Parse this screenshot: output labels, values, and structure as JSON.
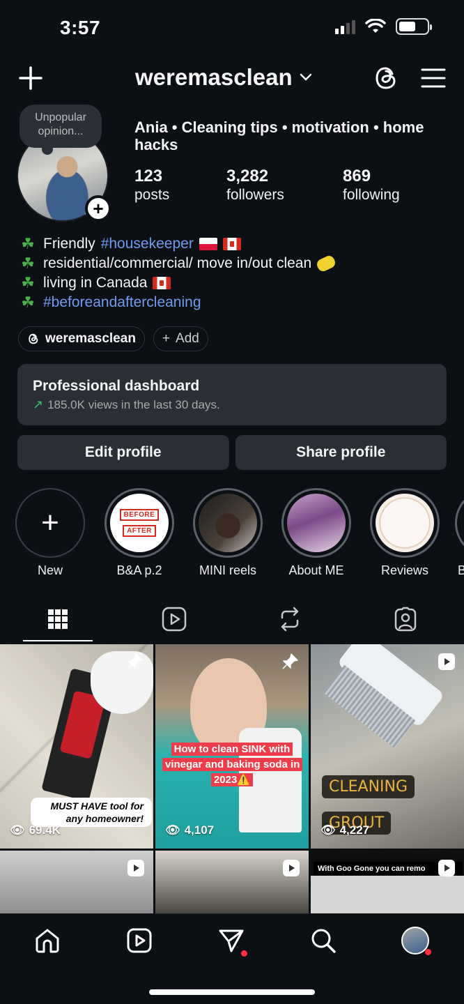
{
  "status_bar": {
    "time": "3:57"
  },
  "header": {
    "username": "weremasclean"
  },
  "profile": {
    "note": "Unpopular opinion...",
    "display_name": "Ania • Cleaning tips • motivation • home hacks",
    "stats": [
      {
        "value": "123",
        "label": "posts"
      },
      {
        "value": "3,282",
        "label": "followers"
      },
      {
        "value": "869",
        "label": "following"
      }
    ],
    "bio": {
      "line1_text": "Friendly",
      "line1_tag": "#housekeeper",
      "line2_text": "residential/commercial/ move in/out clean",
      "line3_text": "living in Canada",
      "line4_tag": "#beforeandaftercleaning"
    },
    "chips": {
      "threads_label": "weremasclean",
      "add_label": "Add"
    }
  },
  "dashboard": {
    "title": "Professional dashboard",
    "subtitle": "185.0K views in the last 30 days."
  },
  "actions": {
    "edit_label": "Edit profile",
    "share_label": "Share profile"
  },
  "highlights": [
    {
      "label": "New"
    },
    {
      "label": "B&A p.2",
      "badge_top": "BEFORE",
      "badge_bottom": "AFTER"
    },
    {
      "label": "MINI reels"
    },
    {
      "label": "About ME"
    },
    {
      "label": "Reviews"
    },
    {
      "label": "B"
    }
  ],
  "posts": [
    {
      "caption": "MUST HAVE tool for any homeowner!",
      "views": "69.4K",
      "pinned": true
    },
    {
      "caption": "How to clean SINK with vinegar and baking soda in 2023⚠️",
      "views": "4,107",
      "pinned": true
    },
    {
      "caption_line1": "CLEANING",
      "caption_line2": "GROUT",
      "views": "4,227",
      "reel": true
    },
    {
      "reel": true
    },
    {
      "reel": true
    },
    {
      "caption": "With Goo Gone you can remo",
      "reel": true
    }
  ],
  "colors": {
    "background": "#0c0f14",
    "card": "#2a2e35",
    "link": "#6f9cf0",
    "trend_up": "#3fbf6f",
    "notification": "#ff3040"
  }
}
